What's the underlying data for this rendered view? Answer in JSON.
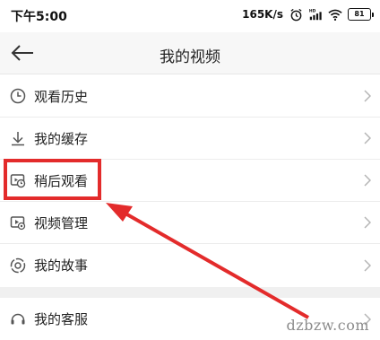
{
  "status_bar": {
    "time": "下午5:00",
    "net_speed": "165K/s",
    "battery_level": "81",
    "icons": [
      "alarm-icon",
      "hd-signal-icon",
      "wifi-icon",
      "battery-icon"
    ]
  },
  "header": {
    "title": "我的视频",
    "back_icon": "back-arrow-icon"
  },
  "menu": {
    "items": [
      {
        "label": "观看历史",
        "icon": "clock-icon"
      },
      {
        "label": "我的缓存",
        "icon": "download-icon"
      },
      {
        "label": "稍后观看",
        "icon": "watch-later-icon"
      },
      {
        "label": "视频管理",
        "icon": "video-manage-icon"
      },
      {
        "label": "我的故事",
        "icon": "story-icon"
      }
    ],
    "secondary_items": [
      {
        "label": "我的客服",
        "icon": "customer-service-icon"
      }
    ]
  },
  "annotation": {
    "highlight_color": "#e32b2b",
    "watermark": "dzbzw.com"
  },
  "colors": {
    "header_bg": "#f7f7f7",
    "divider": "#ececec",
    "section_gap": "#f0f0f0",
    "chevron": "#b5b5b5",
    "icon": "#555555"
  }
}
